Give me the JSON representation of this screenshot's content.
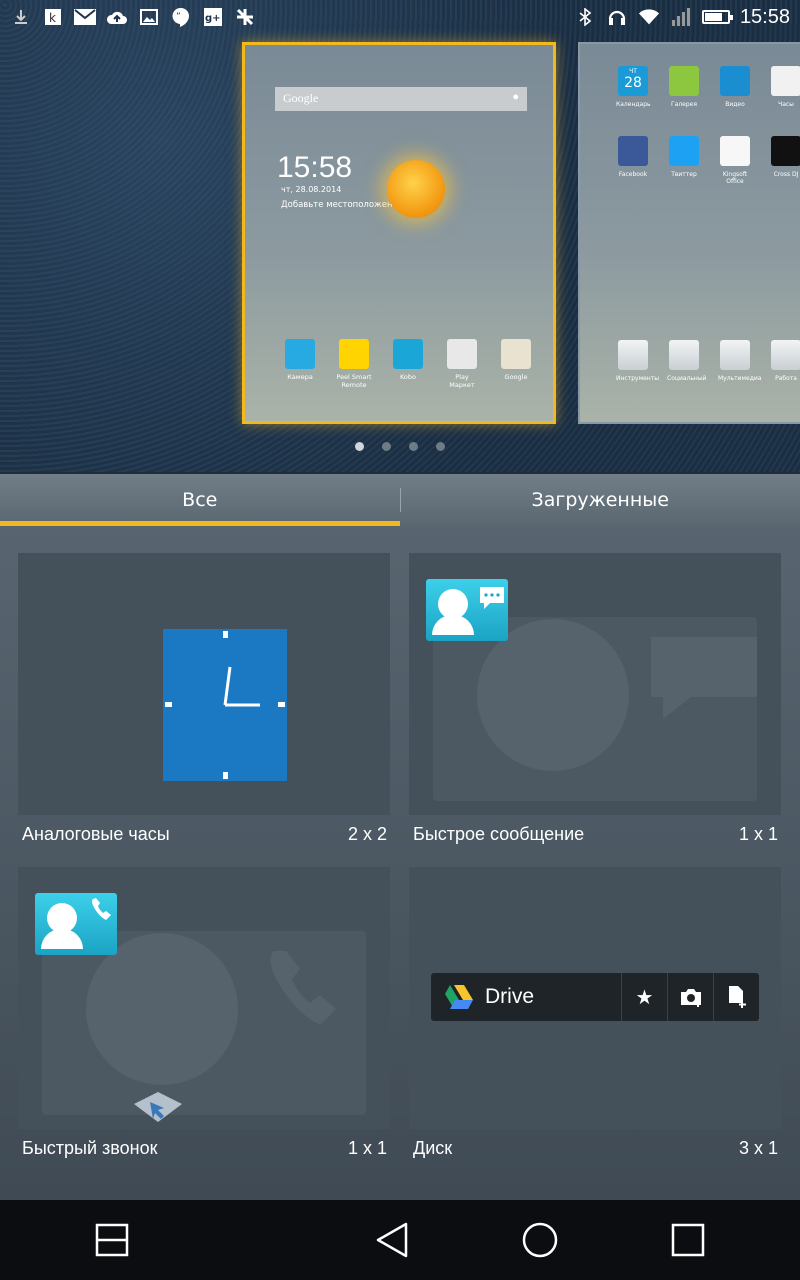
{
  "status_bar": {
    "time": "15:58",
    "left_icons": [
      "download-icon",
      "kobo-icon",
      "gmail-icon",
      "cloud-upload-icon",
      "gallery-icon",
      "hangouts-icon",
      "google-plus-icon",
      "pinwheel-icon"
    ],
    "right_icons": [
      "bluetooth-icon",
      "headset-icon",
      "wifi-icon",
      "signal-icon",
      "battery-icon"
    ]
  },
  "home_preview": {
    "search_label": "Google",
    "clock_time": "15:58",
    "date": "чт, 28.08.2014",
    "location_prompt": "Добавьте местоположение",
    "dock_apps": [
      {
        "label": "Камера",
        "color": "#27a9e1"
      },
      {
        "label": "Peel Smart Remote",
        "color": "#ffd400"
      },
      {
        "label": "Kobo",
        "color": "#1aa6d6"
      },
      {
        "label": "Play Маркет",
        "color": "#e8e8e8"
      },
      {
        "label": "Google",
        "color": "#e9e2d0"
      }
    ],
    "side_apps_row1": [
      {
        "label": "Календарь",
        "color": "#1a9bd7"
      },
      {
        "label": "Галерея",
        "color": "#8dc63f"
      },
      {
        "label": "Видео",
        "color": "#1a8ed1"
      },
      {
        "label": "Часы",
        "color": "#f1f1f1"
      }
    ],
    "side_apps_row2": [
      {
        "label": "Facebook",
        "color": "#3b5998"
      },
      {
        "label": "Твиттер",
        "color": "#1da1f2"
      },
      {
        "label": "Kingsoft Office",
        "color": "#f7f7f7"
      },
      {
        "label": "Cross DJ",
        "color": "#111111"
      }
    ],
    "side_folders": [
      {
        "label": "Инструменты"
      },
      {
        "label": "Социальный"
      },
      {
        "label": "Мультимедиа"
      },
      {
        "label": "Работа"
      }
    ],
    "calendar_day_name": "ЧТ",
    "calendar_day": "28",
    "page_count": 4,
    "active_page": 1
  },
  "tabs": [
    {
      "label": "Все",
      "active": true
    },
    {
      "label": "Загруженные",
      "active": false
    }
  ],
  "widgets": [
    {
      "name": "Аналоговые часы",
      "size": "2 x 2"
    },
    {
      "name": "Быстрое сообщение",
      "size": "1 x 1"
    },
    {
      "name": "Быстрый звонок",
      "size": "1 x 1"
    },
    {
      "name": "Диск",
      "size": "3 x 1"
    }
  ],
  "drive_widget": {
    "label": "Drive"
  },
  "colors": {
    "accent": "#f3b81e",
    "clock_blue": "#1b78c2",
    "contact_cyan": "#2bbfe0"
  },
  "nav": [
    "recent-apps-icon",
    "back-icon",
    "home-icon",
    "overview-icon"
  ]
}
